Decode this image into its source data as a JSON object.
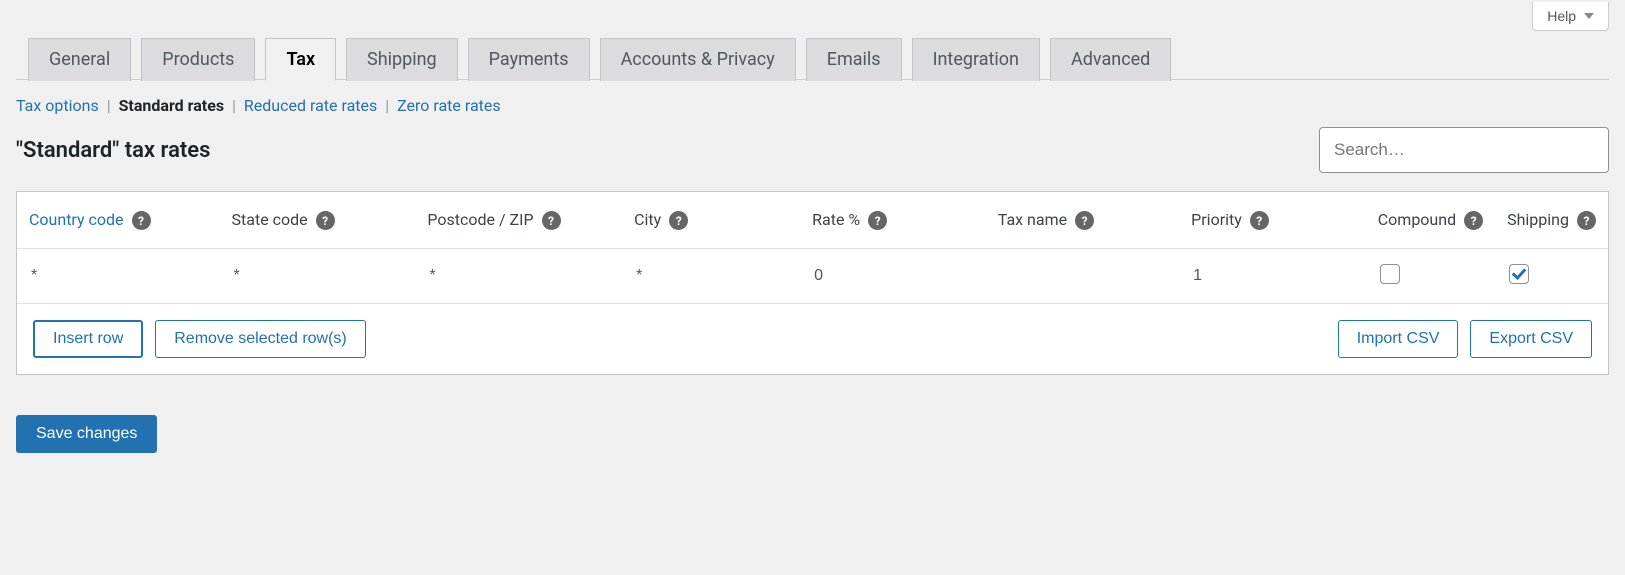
{
  "help_label": "Help",
  "tabs": [
    {
      "label": "General"
    },
    {
      "label": "Products"
    },
    {
      "label": "Tax",
      "active": true
    },
    {
      "label": "Shipping"
    },
    {
      "label": "Payments"
    },
    {
      "label": "Accounts & Privacy"
    },
    {
      "label": "Emails"
    },
    {
      "label": "Integration"
    },
    {
      "label": "Advanced"
    }
  ],
  "subnav": {
    "tax_options": "Tax options",
    "standard_rates": "Standard rates",
    "reduced_rates": "Reduced rate rates",
    "zero_rates": "Zero rate rates"
  },
  "heading": "\"Standard\" tax rates",
  "search_placeholder": "Search…",
  "columns": {
    "country": "Country code",
    "state": "State code",
    "postcode": "Postcode / ZIP",
    "city": "City",
    "rate": "Rate %",
    "tax_name": "Tax name",
    "priority": "Priority",
    "compound": "Compound",
    "shipping": "Shipping"
  },
  "row": {
    "country": "*",
    "state": "*",
    "postcode": "*",
    "city": "*",
    "rate": "0",
    "tax_name": "",
    "priority": "1",
    "compound": false,
    "shipping": true
  },
  "buttons": {
    "insert_row": "Insert row",
    "remove_rows": "Remove selected row(s)",
    "import_csv": "Import CSV",
    "export_csv": "Export CSV",
    "save": "Save changes"
  }
}
